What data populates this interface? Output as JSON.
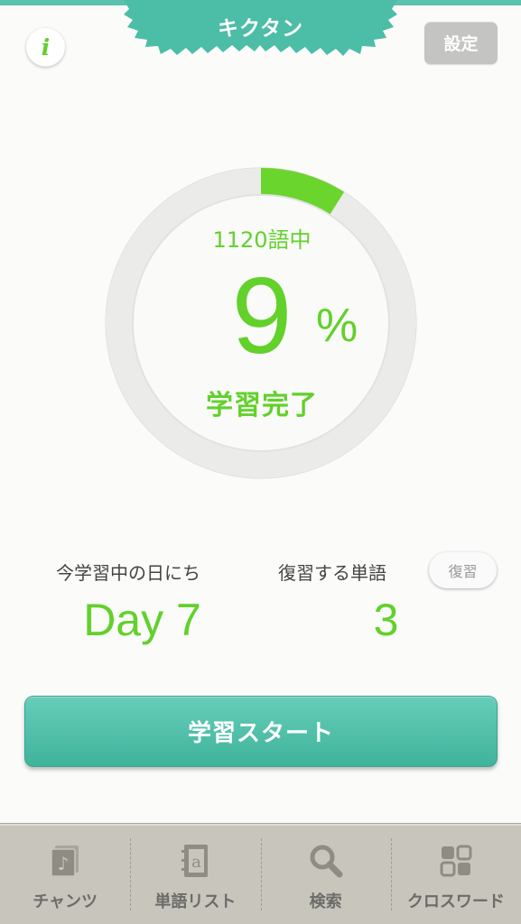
{
  "header": {
    "title": "キクタン",
    "info_label": "i",
    "settings_label": "設定"
  },
  "progress": {
    "total_label": "1120語中",
    "percent_value": "9",
    "percent_sign": "%",
    "status_label": "学習完了",
    "fraction": 0.09,
    "color": "#62d12a",
    "accent": "#5ac2ac"
  },
  "stats": {
    "current_day_label": "今学習中の日にち",
    "current_day_value": "Day 7",
    "review_words_label": "復習する単語",
    "review_words_value": "3",
    "review_button_label": "復習"
  },
  "start_button_label": "学習スタート",
  "tabbar": {
    "items": [
      {
        "label": "チャンツ",
        "icon": "music-note-icon"
      },
      {
        "label": "単語リスト",
        "icon": "notebook-icon"
      },
      {
        "label": "検索",
        "icon": "search-icon"
      },
      {
        "label": "クロスワード",
        "icon": "grid-icon"
      }
    ]
  }
}
